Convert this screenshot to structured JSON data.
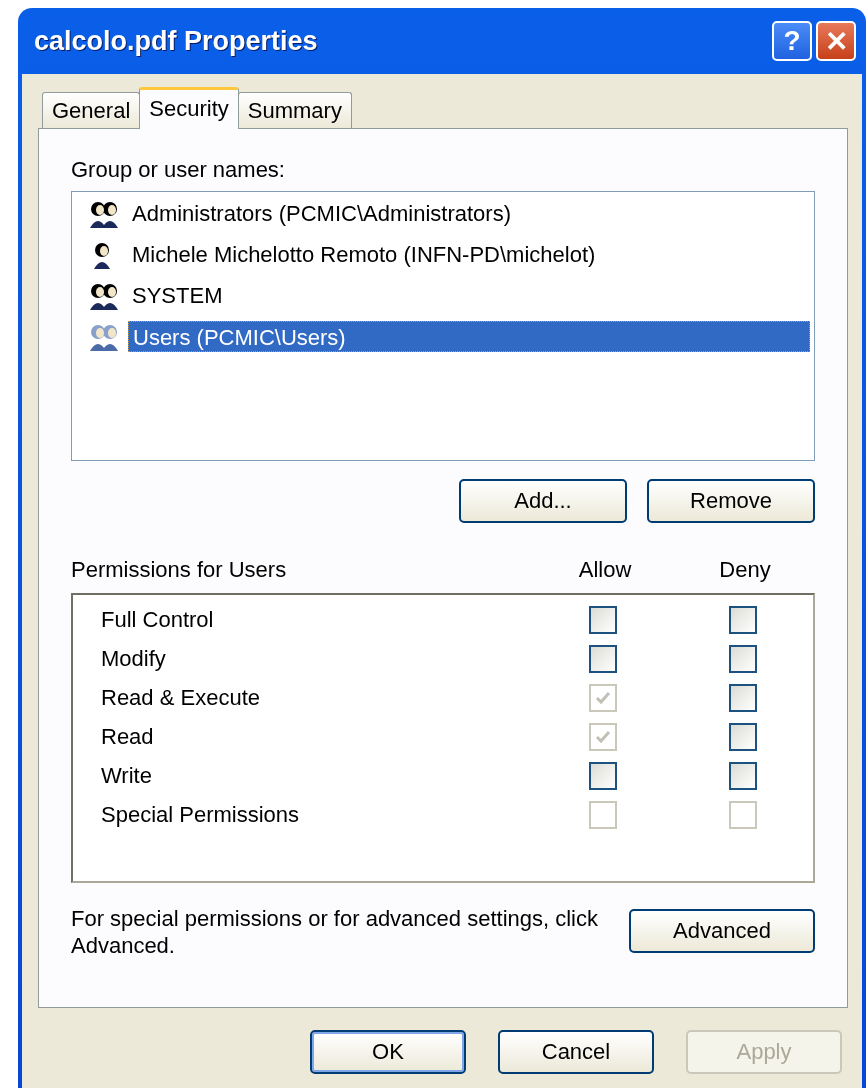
{
  "window": {
    "title": "calcolo.pdf Properties",
    "title_buttons": [
      {
        "kind": "help",
        "label": "?"
      },
      {
        "kind": "close",
        "label": "✕"
      }
    ]
  },
  "tabs": [
    {
      "label": "General",
      "selected": false
    },
    {
      "label": "Security",
      "selected": true
    },
    {
      "label": "Summary",
      "selected": false
    }
  ],
  "users": {
    "label": "Group or user names:",
    "items": [
      {
        "name": "Administrators (PCMIC\\Administrators)",
        "kind": "group",
        "selected": false
      },
      {
        "name": "Michele Michelotto Remoto (INFN-PD\\michelot)",
        "kind": "user",
        "selected": false
      },
      {
        "name": "SYSTEM",
        "kind": "group",
        "selected": false
      },
      {
        "name": "Users (PCMIC\\Users)",
        "kind": "group",
        "selected": true
      }
    ]
  },
  "user_buttons": [
    {
      "label": "Add...",
      "disabled": false
    },
    {
      "label": "Remove",
      "disabled": false
    }
  ],
  "permissions": {
    "label": "Permissions for Users",
    "allow_header": "Allow",
    "deny_header": "Deny",
    "rows": [
      {
        "name": "Full Control",
        "allow": {
          "checked": false,
          "disabled": false
        },
        "deny": {
          "checked": false,
          "disabled": false
        }
      },
      {
        "name": "Modify",
        "allow": {
          "checked": false,
          "disabled": false
        },
        "deny": {
          "checked": false,
          "disabled": false
        }
      },
      {
        "name": "Read & Execute",
        "allow": {
          "checked": true,
          "disabled": true
        },
        "deny": {
          "checked": false,
          "disabled": false
        }
      },
      {
        "name": "Read",
        "allow": {
          "checked": true,
          "disabled": true
        },
        "deny": {
          "checked": false,
          "disabled": false
        }
      },
      {
        "name": "Write",
        "allow": {
          "checked": false,
          "disabled": false
        },
        "deny": {
          "checked": false,
          "disabled": false
        }
      },
      {
        "name": "Special Permissions",
        "allow": {
          "checked": false,
          "disabled": true
        },
        "deny": {
          "checked": false,
          "disabled": true
        }
      }
    ]
  },
  "advanced": {
    "note": "For special permissions or for advanced settings, click Advanced.",
    "button": "Advanced"
  },
  "buttons": [
    {
      "label": "OK",
      "disabled": false,
      "default": true
    },
    {
      "label": "Cancel",
      "disabled": false,
      "default": false
    },
    {
      "label": "Apply",
      "disabled": true,
      "default": false
    }
  ]
}
